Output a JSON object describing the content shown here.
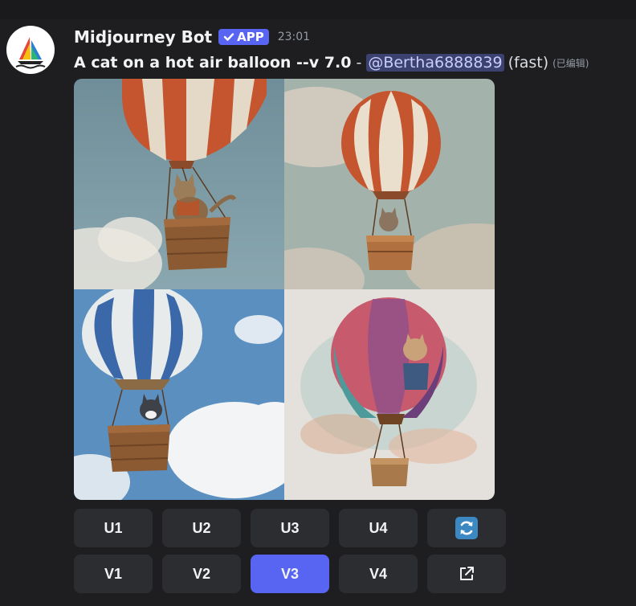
{
  "message": {
    "author": "Midjourney Bot",
    "badge": "APP",
    "timestamp": "23:01",
    "prompt": "A cat on a hot air balloon --v 7.0",
    "separator": "-",
    "mention": "@Bertha6888839",
    "mode": "(fast)",
    "edited": "(已编辑)"
  },
  "icons": {
    "avatar": "midjourney-sailboat-icon",
    "badge": "checkmark-icon",
    "reroll": "refresh-icon",
    "open": "external-link-icon"
  },
  "images": [
    "cat-balloon-image-1",
    "cat-balloon-image-2",
    "cat-balloon-image-3",
    "cat-balloon-image-4"
  ],
  "buttons": {
    "upscale": [
      "U1",
      "U2",
      "U3",
      "U4"
    ],
    "variation": [
      "V1",
      "V2",
      "V3",
      "V4"
    ],
    "active": "V3"
  },
  "colors": {
    "background": "#1e1e21",
    "button": "#2b2d31",
    "accent": "#5865f2",
    "mention_bg": "#3c4270"
  }
}
